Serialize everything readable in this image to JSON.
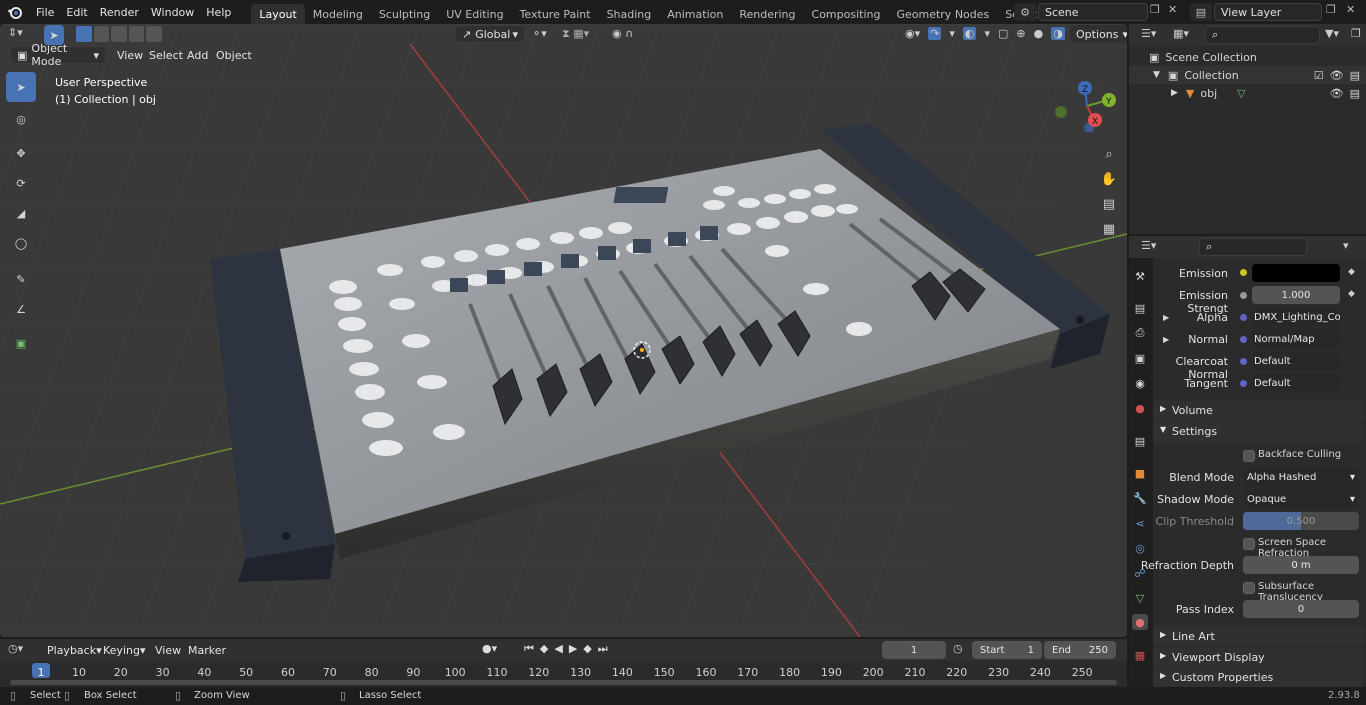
{
  "menus": [
    "File",
    "Edit",
    "Render",
    "Window",
    "Help"
  ],
  "workspaces": [
    "Layout",
    "Modeling",
    "Sculpting",
    "UV Editing",
    "Texture Paint",
    "Shading",
    "Animation",
    "Rendering",
    "Compositing",
    "Geometry Nodes",
    "Scripting"
  ],
  "active_workspace": "Layout",
  "scene": {
    "name": "Scene"
  },
  "view_layer": {
    "name": "View Layer"
  },
  "viewport": {
    "mode": "Object Mode",
    "menus": [
      "View",
      "Select",
      "Add",
      "Object"
    ],
    "transform_orientation": "Global",
    "options_label": "Options",
    "overlay_title": "User Perspective",
    "overlay_subtitle": "(1) Collection | obj",
    "gizmo_axes": {
      "x": "X",
      "y": "Y",
      "z": "Z"
    }
  },
  "outliner": {
    "items": [
      {
        "label": "Scene Collection"
      },
      {
        "label": "Collection"
      },
      {
        "label": "obj"
      }
    ]
  },
  "properties": {
    "rows": [
      {
        "label": "Emission",
        "value": ""
      },
      {
        "label": "Emission Strengt",
        "value": "1.000"
      },
      {
        "label": "Alpha",
        "value": "DMX_Lighting_Contr..."
      },
      {
        "label": "Normal",
        "value": "Normal/Map"
      },
      {
        "label": "Clearcoat Normal",
        "value": "Default"
      },
      {
        "label": "Tangent",
        "value": "Default"
      }
    ],
    "volume_label": "Volume",
    "settings_label": "Settings",
    "backface_culling": "Backface Culling",
    "blend_mode_label": "Blend Mode",
    "blend_mode_value": "Alpha Hashed",
    "shadow_mode_label": "Shadow Mode",
    "shadow_mode_value": "Opaque",
    "clip_threshold_label": "Clip Threshold",
    "clip_threshold_value": "0.500",
    "ssr_label": "Screen Space Refraction",
    "refraction_depth_label": "Refraction Depth",
    "refraction_depth_value": "0 m",
    "subsurface_label": "Subsurface Translucency",
    "pass_index_label": "Pass Index",
    "pass_index_value": "0",
    "line_art": "Line Art",
    "viewport_display": "Viewport Display",
    "custom_properties": "Custom Properties"
  },
  "timeline": {
    "menus": [
      "Playback",
      "Keying",
      "View",
      "Marker"
    ],
    "current_frame": "1",
    "start_label": "Start",
    "start_value": "1",
    "end_label": "End",
    "end_value": "250",
    "ruler": [
      "1",
      "10",
      "20",
      "30",
      "40",
      "50",
      "60",
      "70",
      "80",
      "90",
      "100",
      "110",
      "120",
      "130",
      "140",
      "150",
      "160",
      "170",
      "180",
      "190",
      "200",
      "210",
      "220",
      "230",
      "240",
      "250"
    ]
  },
  "statusbar": {
    "items": [
      "Select",
      "Box Select",
      "Zoom View",
      "Lasso Select"
    ],
    "version": "2.93.8"
  },
  "colors": {
    "accent": "#4772b3",
    "header": "#303030",
    "panel": "#2b2b2b",
    "viewport_bg": "#393939"
  }
}
